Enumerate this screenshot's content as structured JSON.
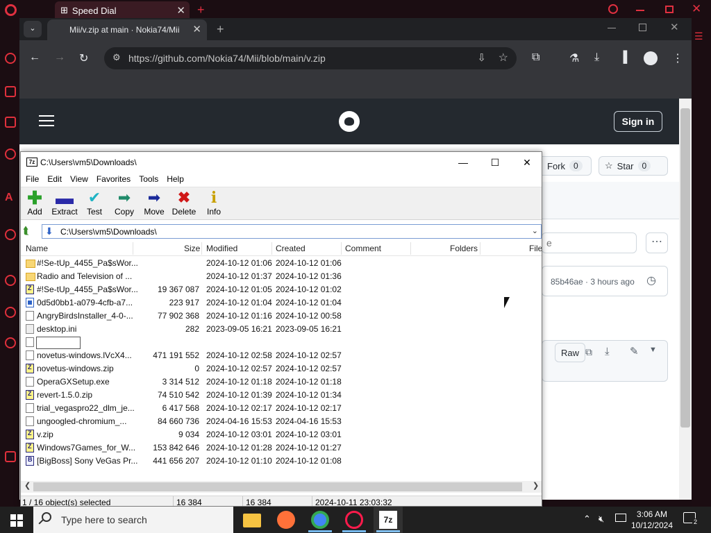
{
  "opera": {
    "tab_title": "Speed Dial"
  },
  "chrome": {
    "tab_title": "Mii/v.zip at main · Nokia74/Mii",
    "url": "https://github.com/Nokia74/Mii/blob/main/v.zip"
  },
  "github": {
    "signin_label": "Sign in",
    "fork_label": "Fork",
    "fork_count": "0",
    "star_label": "Star",
    "star_count": "0",
    "search_partial": "e",
    "commit_text": "85b46ae · 3 hours ago",
    "raw_label": "Raw"
  },
  "sevenzip": {
    "title": "C:\\Users\\vm5\\Downloads\\",
    "path": "C:\\Users\\vm5\\Downloads\\",
    "menu": [
      "File",
      "Edit",
      "View",
      "Favorites",
      "Tools",
      "Help"
    ],
    "toolbar": [
      {
        "label": "Add",
        "icon": "plus-icon",
        "color": "#2aa12a"
      },
      {
        "label": "Extract",
        "icon": "minus-icon",
        "color": "#2a2aa8"
      },
      {
        "label": "Test",
        "icon": "check-icon",
        "color": "#1fb3c4"
      },
      {
        "label": "Copy",
        "icon": "copy-arrow-icon",
        "color": "#1f8a6a"
      },
      {
        "label": "Move",
        "icon": "move-arrow-icon",
        "color": "#1a2a9a"
      },
      {
        "label": "Delete",
        "icon": "delete-x-icon",
        "color": "#d01818"
      },
      {
        "label": "Info",
        "icon": "info-icon",
        "color": "#c8a000"
      }
    ],
    "columns": [
      "Name",
      "Size",
      "Modified",
      "Created",
      "Comment",
      "Folders",
      "File"
    ],
    "rows": [
      {
        "name": "#!Se-tUp_4455_Pa$sWor...",
        "size": "",
        "modified": "2024-10-12 01:06",
        "created": "2024-10-12 01:06",
        "icon": "folder"
      },
      {
        "name": "Radio and Television of ...",
        "size": "",
        "modified": "2024-10-12 01:37",
        "created": "2024-10-12 01:36",
        "icon": "folder"
      },
      {
        "name": "#!Se-tUp_4455_Pa$sWor...",
        "size": "19 367 087",
        "modified": "2024-10-12 01:05",
        "created": "2024-10-12 01:02",
        "icon": "zip"
      },
      {
        "name": "0d5d0bb1-a079-4cfb-a7...",
        "size": "223 917",
        "modified": "2024-10-12 01:04",
        "created": "2024-10-12 01:04",
        "icon": "exe"
      },
      {
        "name": "AngryBirdsInstaller_4-0-...",
        "size": "77 902 368",
        "modified": "2024-10-12 01:16",
        "created": "2024-10-12 00:58",
        "icon": "file"
      },
      {
        "name": "desktop.ini",
        "size": "282",
        "modified": "2023-09-05 16:21",
        "created": "2023-09-05 16:21",
        "icon": "ini"
      },
      {
        "name": "",
        "size": "",
        "modified": "",
        "created": "",
        "icon": "file"
      },
      {
        "name": "novetus-windows.lVcX4...",
        "size": "471 191 552",
        "modified": "2024-10-12 02:58",
        "created": "2024-10-12 02:57",
        "icon": "file"
      },
      {
        "name": "novetus-windows.zip",
        "size": "0",
        "modified": "2024-10-12 02:57",
        "created": "2024-10-12 02:57",
        "icon": "zip"
      },
      {
        "name": "OperaGXSetup.exe",
        "size": "3 314 512",
        "modified": "2024-10-12 01:18",
        "created": "2024-10-12 01:18",
        "icon": "file"
      },
      {
        "name": "revert-1.5.0.zip",
        "size": "74 510 542",
        "modified": "2024-10-12 01:39",
        "created": "2024-10-12 01:34",
        "icon": "zip"
      },
      {
        "name": "trial_vegaspro22_dlm_je...",
        "size": "6 417 568",
        "modified": "2024-10-12 02:17",
        "created": "2024-10-12 02:17",
        "icon": "file"
      },
      {
        "name": "ungoogled-chromium_...",
        "size": "84 660 736",
        "modified": "2024-04-16 15:53",
        "created": "2024-04-16 15:53",
        "icon": "file"
      },
      {
        "name": "v.zip",
        "size": "9 034",
        "modified": "2024-10-12 03:01",
        "created": "2024-10-12 03:01",
        "icon": "zip"
      },
      {
        "name": "Windows7Games_for_W...",
        "size": "153 842 646",
        "modified": "2024-10-12 01:28",
        "created": "2024-10-12 01:27",
        "icon": "zip"
      },
      {
        "name": "[BigBoss] Sony VeGas Pr...",
        "size": "441 656 207",
        "modified": "2024-10-12 01:10",
        "created": "2024-10-12 01:08",
        "icon": "bb"
      }
    ],
    "status": {
      "selected": "1 / 16 object(s) selected",
      "size1": "16 384",
      "size2": "16 384",
      "date": "2024-10-11 23:03:32"
    }
  },
  "taskbar": {
    "search_placeholder": "Type here to search",
    "time": "3:06 AM",
    "date": "10/12/2024",
    "notifications": "2"
  }
}
